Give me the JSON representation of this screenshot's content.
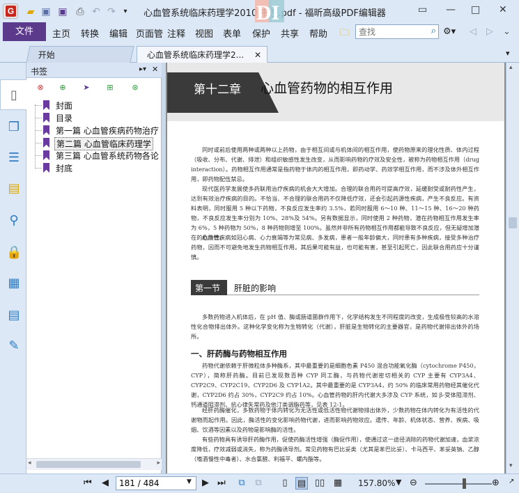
{
  "window": {
    "title": "心血管系统临床药理学2010 书签.pdf - 福昕高级PDF编辑器"
  },
  "menu": {
    "file": "文件",
    "items": [
      "主页",
      "转换",
      "编辑",
      "页面管",
      "注释",
      "视图",
      "表单",
      "保护",
      "共享",
      "帮助"
    ]
  },
  "search": {
    "placeholder": "查找"
  },
  "tabs": {
    "home": "开始",
    "doc": "心血管系统临床药理学2..."
  },
  "bookmarks": {
    "title": "书签",
    "items": [
      "封面",
      "目录",
      "第一篇 心血管疾病药物治疗",
      "第二篇 心血管临床药理学",
      "第三篇 心血管系统药物各论",
      "封底"
    ],
    "selected_index": 3
  },
  "document": {
    "chapter_num": "第十二章",
    "chapter_title": "心血管药物的相互作用",
    "para1": "同时或前后使用两种或两种以上药物，由于相互间或与机体间的相互作用，使药物原来的理化性质、体内过程（吸收、分布、代谢、排泄）和组织敏感性发生改变，从而影响药物的疗效及安全性，被称为药物相互作用（drug interaction）。药物相互作用通常是指药物于体内的相互作用，即药动学、药效学相互作用，而不涉及体外相互作用，即药物配伍禁忌。",
    "para2": "现代医药学发展使多药联用治疗疾病的机会大大增加。合理的联合用药可提高疗效，延缓耐受或耐药性产生，达到有效治疗疾病的目的。不恰当、不合理的联合用药不仅降低疗效，还会引起药源性疾病，产生不良反应。有资料表明，同时服用 5 种以下药物，不良反应发生率约 3.5%，若同时服用 6～10 种、11～15 种、16～20 种药物，不良反应发生率分别为 10%、28%及 54%。另有数据显示，同时使用 2 种药物，潜在药物相互作用发生率为 6%，5 种药物为 50%，8 种药物则增至 100%。虽然并非所有药物相互作用都能导致不良反应，但无疑增加潜在的危险性。",
    "para3": "心血管疾病如冠心病、心力衰竭等为常见病、多发病，患者一般年龄偏大，同时患有多种疾病，接受多种治疗药物，因而不可避免地发生药物相互作用。其后果可能有益，也可能有害，甚至引起死亡，因此联合用药应十分谨慎。",
    "section_label": "第一节",
    "section_title": "肝脏的影响",
    "para4": "多数药物进入机体后，在 pH 值、酶或肠道菌群作用下，化学结构发生不同程度的改变，生成极性较高的水溶性化合物排出体外。这种化学变化称为生物转化（代谢），肝脏是生物转化的主要器官，是药物代谢排出体外的场所。",
    "subsection": "一、肝药酶与药物相互作用",
    "para5": "药物代谢依赖于肝微粒体多种酶系，其中最重要的是细胞色素 P450 混合功能氧化酶（cytochrome P450，CYP），简称肝药酶。目前已发现数百种 CYP 同工酶，与药物代谢密切相关的 CYP 主要有 CYP3A4、CYP2C9、CYP2C19、CYP2D6 及 CYP1A2。其中最重要的是 CYP3A4，约 50% 的临床常用药物经其催化代谢，CYP2D6 约占 30%，CYP2C9 约占 10%。心血管药物的肝内代谢大多涉及 CYP 系统，如 β-受体阻滞剂、钙通道阻滞剂、抗心律失常药及他汀类调脂药等，见表 12-1。",
    "para6": "经肝药酶催化，多数药物于体内转化为无活性或低活性物代谢物排出体外，少数药物在体内转化为有活性的代谢物而起作用。因此，酶活性的变化影响药物代谢，进而影响药物效应。遗传、年龄、机体状态、营养、疾病、吸烟、饮酒等因素以及药物是影响酶的活性。",
    "para7": "有些药物具有诱导肝药酶作用，促使药酶活性增强（酶促作用），使通过这一途径消除的药物代谢加速，血浆浓度降低，疗效减弱或消失，称为药酶诱导剂。常见药物有巴比妥类（尤其是苯巴比妥）、卡马西平、苯妥英钠、乙醇（嗜酒慢性中毒者）、水合氯醛、利福平、螺内酯等。"
  },
  "status": {
    "page": "181 / 484",
    "zoom": "157.80%"
  }
}
